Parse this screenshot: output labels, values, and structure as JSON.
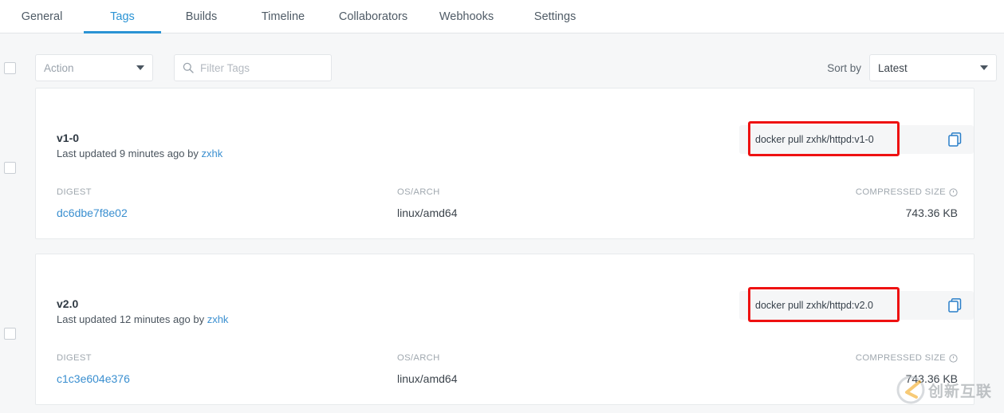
{
  "tabs": [
    {
      "label": "General",
      "active": false
    },
    {
      "label": "Tags",
      "active": true
    },
    {
      "label": "Builds",
      "active": false
    },
    {
      "label": "Timeline",
      "active": false
    },
    {
      "label": "Collaborators",
      "active": false
    },
    {
      "label": "Webhooks",
      "active": false
    },
    {
      "label": "Settings",
      "active": false
    }
  ],
  "toolbar": {
    "action_label": "Action",
    "filter_placeholder": "Filter Tags",
    "sort_label": "Sort by",
    "sort_value": "Latest"
  },
  "columns": {
    "digest": "DIGEST",
    "osarch": "OS/ARCH",
    "compressed_size": "COMPRESSED SIZE"
  },
  "tags": [
    {
      "name": "v1-0",
      "updated_prefix": "Last updated",
      "updated_when": "9 minutes ago",
      "updated_by_word": "by",
      "updated_by": "zxhk",
      "pull_command": "docker pull zxhk/httpd:v1-0",
      "digest": "dc6dbe7f8e02",
      "osarch": "linux/amd64",
      "size": "743.36 KB"
    },
    {
      "name": "v2.0",
      "updated_prefix": "Last updated",
      "updated_when": "12 minutes ago",
      "updated_by_word": "by",
      "updated_by": "zxhk",
      "pull_command": "docker pull zxhk/httpd:v2.0",
      "digest": "c1c3e604e376",
      "osarch": "linux/amd64",
      "size": "743.36 KB"
    }
  ],
  "watermark": {
    "text": "创新互联"
  },
  "colors": {
    "accent": "#2a93d4",
    "link": "#3a8fd0",
    "annotation": "#ee1111",
    "page_bg": "#f6f7f8",
    "card_bg": "#ffffff"
  },
  "icons": {
    "search": "search-icon",
    "copy": "copy-icon",
    "info": "info-icon",
    "caret": "chevron-down-icon"
  }
}
